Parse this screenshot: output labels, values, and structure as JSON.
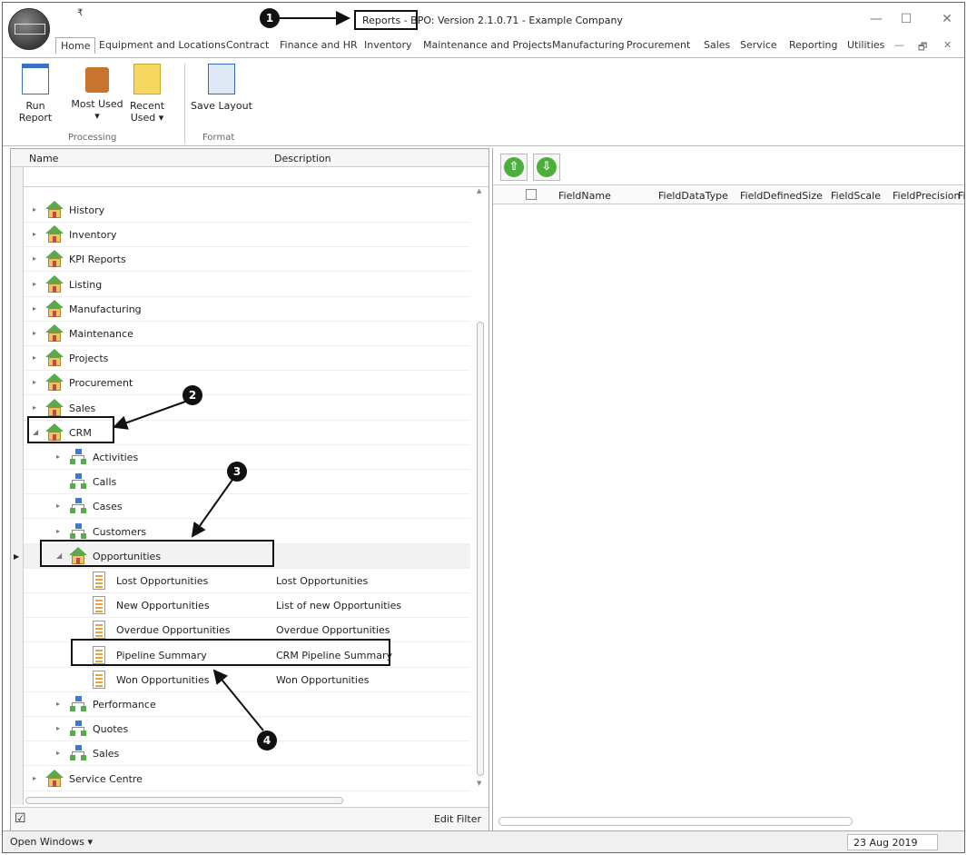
{
  "titlebar": {
    "title": "Reports - BPO: Version 2.1.0.71 - Example Company",
    "minimize": "—",
    "maximize": "☐",
    "close": "✕",
    "qat": "₹"
  },
  "tabs": [
    "Home",
    "Equipment and Locations",
    "Contract",
    "Finance and HR",
    "Inventory",
    "Maintenance and Projects",
    "Manufacturing",
    "Procurement",
    "Sales",
    "Service",
    "Reporting",
    "Utilities"
  ],
  "tab_extras": {
    "dash": "—",
    "restore": "🗗",
    "close": "✕"
  },
  "ribbon": {
    "run_report": "Run Report",
    "most_used": "Most Used",
    "most_used_arrow": "▾",
    "recent": "Recent",
    "recent_used": "Used ▾",
    "save_layout": "Save Layout",
    "group_processing": "Processing",
    "group_format": "Format"
  },
  "tree": {
    "col_name": "Name",
    "col_desc": "Description",
    "filter_icon": "₹",
    "items": [
      {
        "label": "History",
        "desc": ""
      },
      {
        "label": "Inventory",
        "desc": ""
      },
      {
        "label": "KPI Reports",
        "desc": ""
      },
      {
        "label": "Listing",
        "desc": ""
      },
      {
        "label": "Manufacturing",
        "desc": ""
      },
      {
        "label": "Maintenance",
        "desc": ""
      },
      {
        "label": "Projects",
        "desc": ""
      },
      {
        "label": "Procurement",
        "desc": ""
      },
      {
        "label": "Sales",
        "desc": ""
      },
      {
        "label": "CRM",
        "desc": ""
      },
      {
        "label": "Activities",
        "desc": ""
      },
      {
        "label": "Calls",
        "desc": ""
      },
      {
        "label": "Cases",
        "desc": ""
      },
      {
        "label": "Customers",
        "desc": ""
      },
      {
        "label": "Opportunities",
        "desc": ""
      },
      {
        "label": "Lost Opportunities",
        "desc": "Lost Opportunities"
      },
      {
        "label": "New Opportunities",
        "desc": "List of new Opportunities"
      },
      {
        "label": "Overdue Opportunities",
        "desc": "Overdue Opportunities"
      },
      {
        "label": "Pipeline Summary",
        "desc": "CRM Pipeline Summary"
      },
      {
        "label": "Won Opportunities",
        "desc": "Won Opportunities"
      },
      {
        "label": "Performance",
        "desc": ""
      },
      {
        "label": "Quotes",
        "desc": ""
      },
      {
        "label": "Sales",
        "desc": ""
      },
      {
        "label": "Service Centre",
        "desc": ""
      }
    ],
    "edit_filter": "Edit Filter",
    "checkbox": "☑"
  },
  "grid": {
    "columns": [
      "FieldName",
      "FieldDataType",
      "FieldDefinedSize",
      "FieldScale",
      "FieldPrecision",
      "Fi"
    ],
    "up_arrow": "⇧",
    "down_arrow": "⇩"
  },
  "status": {
    "open_windows": "Open Windows ▾",
    "date": "23 Aug 2019"
  },
  "callouts": [
    "1",
    "2",
    "3",
    "4"
  ]
}
